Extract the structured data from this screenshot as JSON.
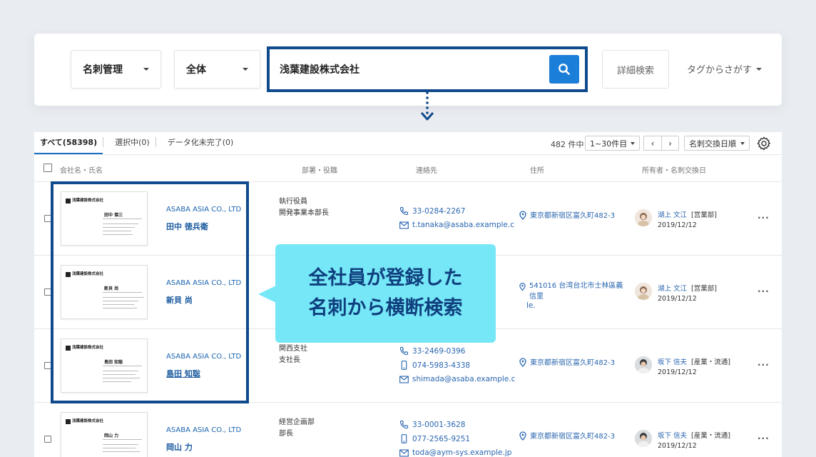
{
  "search": {
    "category": "名刺管理",
    "scope": "全体",
    "query": "浅葉建設株式会社",
    "detail_label": "詳細検索",
    "tag_label": "タグからさがす"
  },
  "list": {
    "tabs": [
      "すべて(58398)",
      "選択中(0)",
      "データ化未完了(0)"
    ],
    "count": "482 件中",
    "pager": "1~30件目",
    "sort": "名刺交換日順",
    "columns": {
      "company": "会社名・氏名",
      "dept": "部署・役職",
      "contact": "連絡先",
      "address": "住所",
      "owner": "所有者・名刺交換日"
    },
    "rows": [
      {
        "card_company": "浅葉建設株式会社",
        "card_person": "田中 傑三",
        "company": "ASABA ASIA CO., LTD",
        "person": "田中 徳兵衛",
        "dept": [
          "執行役員",
          "開発事業本部長"
        ],
        "phone": "33-0284-2267",
        "mobile": "",
        "email": "t.tanaka@asaba.example.c",
        "address": "東京都新宿区富久町482-3",
        "owner": "湖上 文江",
        "owner_dept": "[営業部]",
        "date": "2019/12/12"
      },
      {
        "card_company": "浅葉建設株式会社",
        "card_person": "新貝 尚",
        "company": "ASABA ASIA CO., LTD",
        "person": "新貝 尚",
        "dept": [],
        "phone": "",
        "mobile": "",
        "email": "le.",
        "address": "541016 台湾台北市士林區義信里",
        "owner": "湖上 文江",
        "owner_dept": "[営業部]",
        "date": "2019/12/12"
      },
      {
        "card_company": "浅葉建設株式会社",
        "card_person": "島田 知聡",
        "company": "ASABA ASIA CO., LTD",
        "person": "島田 知聡",
        "dept": [
          "関西支社",
          "支社長"
        ],
        "phone": "33-2469-0396",
        "mobile": "074-5983-4338",
        "email": "shimada@asaba.example.c",
        "address": "東京都新宿区富久町482-3",
        "owner": "坂下 信夫",
        "owner_dept": "[産業・流通]",
        "date": "2019/12/12"
      },
      {
        "card_company": "浅葉建設株式会社",
        "card_person": "岡山 力",
        "company": "ASABA ASIA CO., LTD",
        "person": "岡山 力",
        "dept": [
          "経営企画部",
          "部長"
        ],
        "phone": "33-0001-3628",
        "mobile": "077-2565-9251",
        "email": "toda@aym-sys.example.jp",
        "address": "東京都新宿区富久町482-3",
        "owner": "坂下 信夫",
        "owner_dept": "[産業・流通]",
        "date": "2019/12/12"
      }
    ]
  },
  "callout": {
    "line1": "全社員が登録した",
    "line2": "名刺から横断検索"
  },
  "colors": {
    "accent": "#0f4a8c",
    "search_button": "#1b7fd9",
    "callout_bg": "#76e7f7",
    "link": "#2a66b0"
  }
}
